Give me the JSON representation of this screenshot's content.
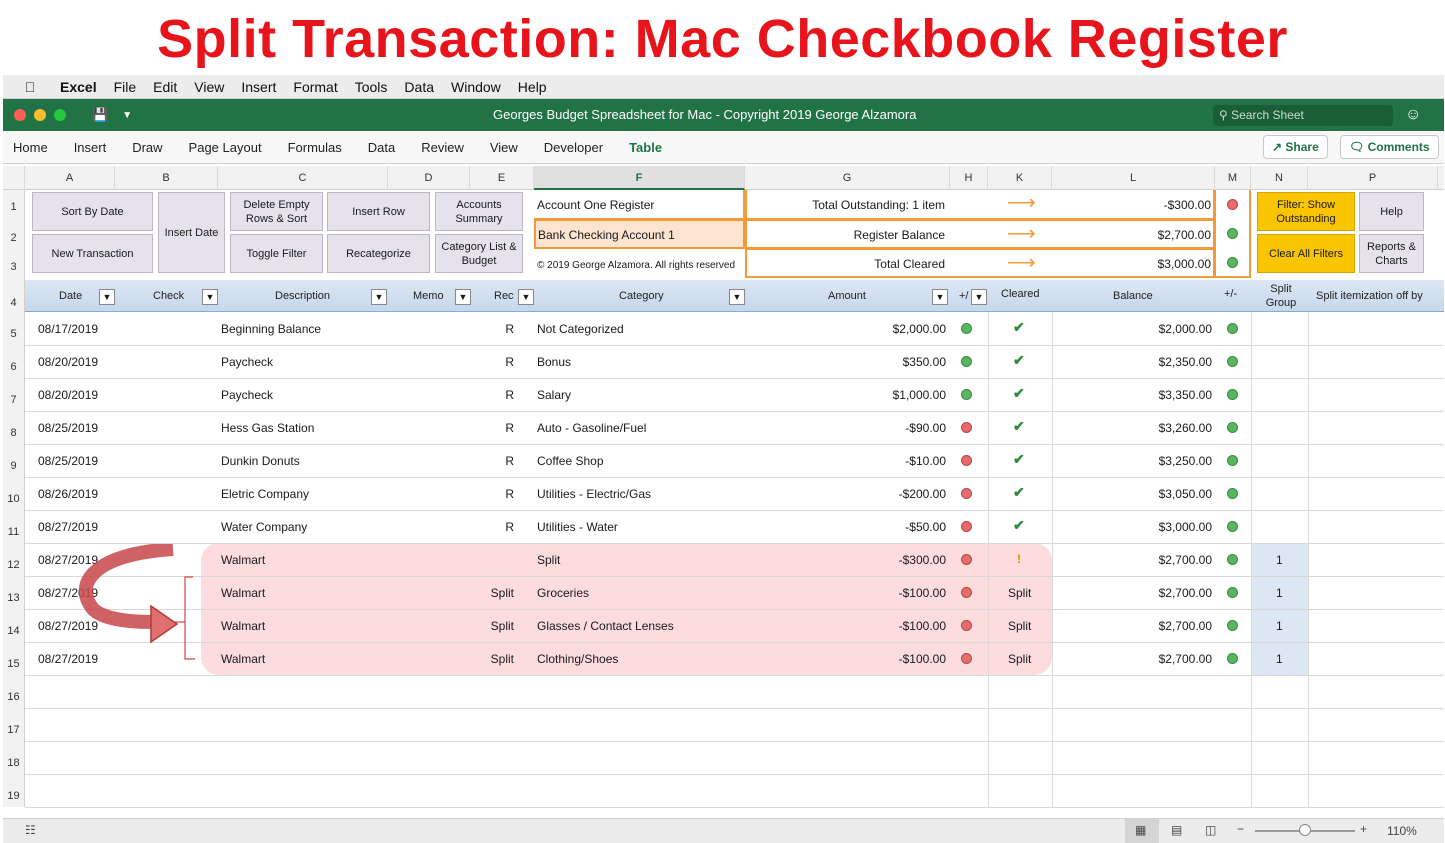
{
  "page_title": "Split Transaction: Mac Checkbook Register",
  "menubar": [
    "Excel",
    "File",
    "Edit",
    "View",
    "Insert",
    "Format",
    "Tools",
    "Data",
    "Window",
    "Help"
  ],
  "window_title": "Georges Budget Spreadsheet for Mac - Copyright 2019 George Alzamora",
  "search_placeholder": "Search Sheet",
  "ribbon_tabs": [
    "Home",
    "Insert",
    "Draw",
    "Page Layout",
    "Formulas",
    "Data",
    "Review",
    "View",
    "Developer",
    "Table"
  ],
  "share_label": "Share",
  "comments_label": "Comments",
  "column_letters": [
    "A",
    "B",
    "C",
    "D",
    "E",
    "F",
    "G",
    "H",
    "K",
    "L",
    "M",
    "N",
    "P"
  ],
  "buttons": {
    "sort_by_date": "Sort By Date",
    "insert_date": "Insert Date",
    "delete_empty": "Delete Empty Rows & Sort",
    "insert_row": "Insert Row",
    "accounts_summary": "Accounts Summary",
    "new_transaction": "New Transaction",
    "toggle_filter": "Toggle Filter",
    "recategorize": "Recategorize",
    "category_list": "Category List & Budget",
    "filter_outstanding": "Filter: Show Outstanding",
    "help": "Help",
    "clear_filters": "Clear All Filters",
    "reports": "Reports & Charts"
  },
  "summary": {
    "register_name": "Account One Register",
    "account_name": "Bank Checking Account 1",
    "copyright": "© 2019 George Alzamora. All rights reserved",
    "rows": [
      {
        "label": "Total Outstanding: 1 item",
        "value": "-$300.00",
        "status": "red"
      },
      {
        "label": "Register Balance",
        "value": "$2,700.00",
        "status": "green"
      },
      {
        "label": "Total Cleared",
        "value": "$3,000.00",
        "status": "green"
      }
    ]
  },
  "table_headers": {
    "date": "Date",
    "check": "Check",
    "description": "Description",
    "memo": "Memo",
    "rec": "Rec",
    "category": "Category",
    "amount": "Amount",
    "plusminus": "+/",
    "cleared": "Cleared",
    "balance": "Balance",
    "plusminus2": "+/-",
    "split_group": "Split Group",
    "split_itemization": "Split itemization off by"
  },
  "rows": [
    {
      "num": "5",
      "date": "08/17/2019",
      "desc": "Beginning Balance",
      "rec": "R",
      "memo": "",
      "category": "Not Categorized",
      "amount": "$2,000.00",
      "amt_status": "green",
      "cleared": "check",
      "balance": "$2,000.00",
      "split": ""
    },
    {
      "num": "6",
      "date": "08/20/2019",
      "desc": "Paycheck",
      "rec": "R",
      "memo": "",
      "category": "Bonus",
      "amount": "$350.00",
      "amt_status": "green",
      "cleared": "check",
      "balance": "$2,350.00",
      "split": ""
    },
    {
      "num": "7",
      "date": "08/20/2019",
      "desc": "Paycheck",
      "rec": "R",
      "memo": "",
      "category": "Salary",
      "amount": "$1,000.00",
      "amt_status": "green",
      "cleared": "check",
      "balance": "$3,350.00",
      "split": ""
    },
    {
      "num": "8",
      "date": "08/25/2019",
      "desc": "Hess Gas Station",
      "rec": "R",
      "memo": "",
      "category": "Auto - Gasoline/Fuel",
      "amount": "-$90.00",
      "amt_status": "red",
      "cleared": "check",
      "balance": "$3,260.00",
      "split": ""
    },
    {
      "num": "9",
      "date": "08/25/2019",
      "desc": "Dunkin Donuts",
      "rec": "R",
      "memo": "",
      "category": "Coffee Shop",
      "amount": "-$10.00",
      "amt_status": "red",
      "cleared": "check",
      "balance": "$3,250.00",
      "split": ""
    },
    {
      "num": "10",
      "date": "08/26/2019",
      "desc": "Eletric Company",
      "rec": "R",
      "memo": "",
      "category": "Utilities - Electric/Gas",
      "amount": "-$200.00",
      "amt_status": "red",
      "cleared": "check",
      "balance": "$3,050.00",
      "split": ""
    },
    {
      "num": "11",
      "date": "08/27/2019",
      "desc": "Water Company",
      "rec": "R",
      "memo": "",
      "category": "Utilities - Water",
      "amount": "-$50.00",
      "amt_status": "red",
      "cleared": "check",
      "balance": "$3,000.00",
      "split": ""
    },
    {
      "num": "12",
      "date": "08/27/2019",
      "desc": "Walmart",
      "rec": "",
      "memo": "",
      "category": "Split",
      "amount": "-$300.00",
      "amt_status": "red",
      "cleared": "!",
      "balance": "$2,700.00",
      "split": "1"
    },
    {
      "num": "13",
      "date": "08/27/2019",
      "desc": "Walmart",
      "rec": "Split",
      "memo": "",
      "category": "Groceries",
      "amount": "-$100.00",
      "amt_status": "red",
      "cleared": "Split",
      "balance": "$2,700.00",
      "split": "1"
    },
    {
      "num": "14",
      "date": "08/27/2019",
      "desc": "Walmart",
      "rec": "Split",
      "memo": "",
      "category": "Glasses / Contact Lenses",
      "amount": "-$100.00",
      "amt_status": "red",
      "cleared": "Split",
      "balance": "$2,700.00",
      "split": "1"
    },
    {
      "num": "15",
      "date": "08/27/2019",
      "desc": "Walmart",
      "rec": "Split",
      "memo": "",
      "category": "Clothing/Shoes",
      "amount": "-$100.00",
      "amt_status": "red",
      "cleared": "Split",
      "balance": "$2,700.00",
      "split": "1"
    }
  ],
  "empty_rows": [
    "16",
    "17",
    "18",
    "19"
  ],
  "top_rows": [
    "1",
    "2",
    "3",
    "4"
  ],
  "zoom": "110%",
  "colors": {
    "excel_green": "#217346",
    "title_red": "#e8141c",
    "orange": "#f39a3a",
    "pink": "#fcdcdc",
    "yellow": "#f9c400"
  }
}
